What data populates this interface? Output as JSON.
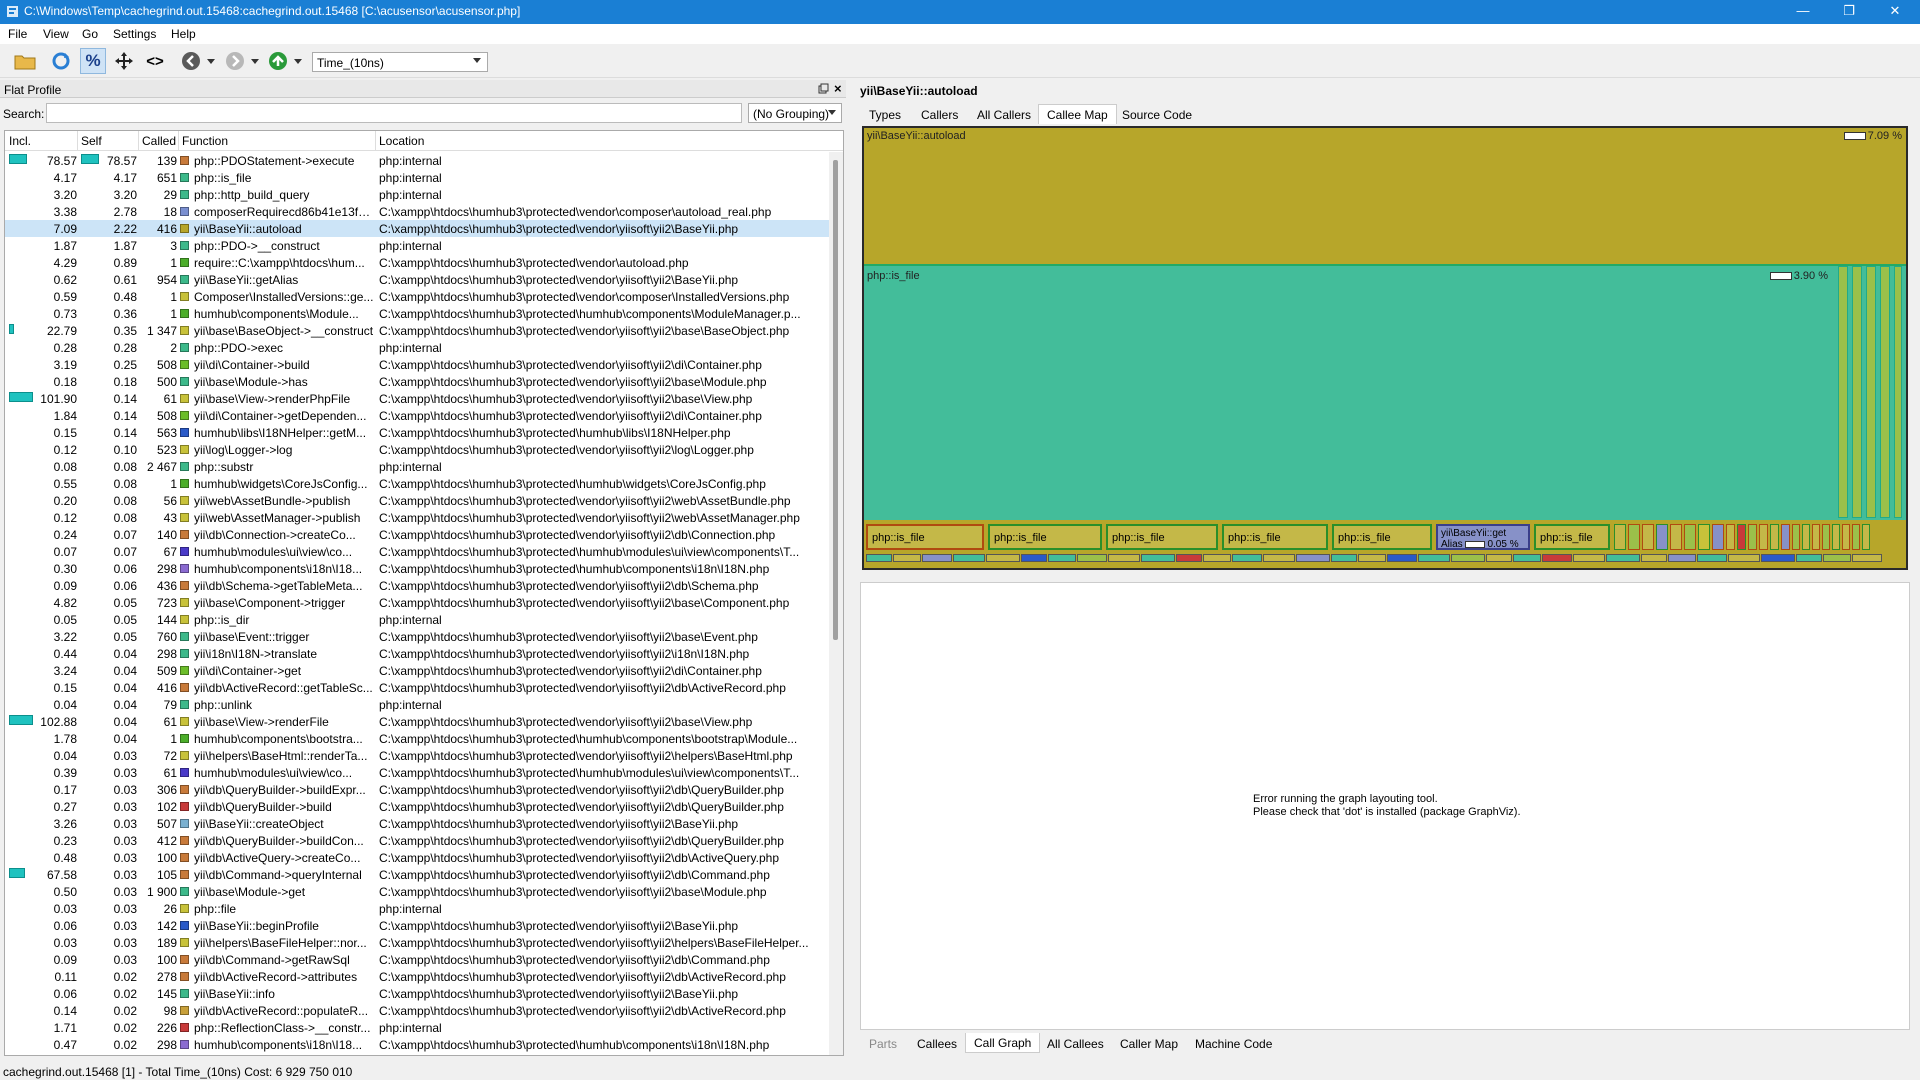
{
  "window": {
    "title": "C:\\Windows\\Temp\\cachegrind.out.15468:cachegrind.out.15468 [C:\\acusensor\\acusensor.php]"
  },
  "menu": [
    "File",
    "View",
    "Go",
    "Settings",
    "Help"
  ],
  "toolbar": {
    "event_type": "Time_(10ns)"
  },
  "flat_profile": {
    "title": "Flat Profile",
    "search_label": "Search:",
    "search_value": "",
    "grouping": "(No Grouping)",
    "columns": [
      "Incl.",
      "Self",
      "Called",
      "Function",
      "Location"
    ],
    "rows": [
      {
        "incl": "78.57",
        "self": "78.57",
        "called": "139",
        "func": "php::PDOStatement->execute",
        "loc": "php:internal",
        "color": "#c87a3a",
        "bar_incl": 0.77,
        "bar_self": 0.77
      },
      {
        "incl": "4.17",
        "self": "4.17",
        "called": "651",
        "func": "php::is_file",
        "loc": "php:internal",
        "color": "#3cb98a"
      },
      {
        "incl": "3.20",
        "self": "3.20",
        "called": "29",
        "func": "php::http_build_query",
        "loc": "php:internal",
        "color": "#3cb98a"
      },
      {
        "incl": "3.38",
        "self": "2.78",
        "called": "18",
        "func": "composerRequirecd86b41e13f5...",
        "loc": "C:\\xampp\\htdocs\\humhub3\\protected\\vendor\\composer\\autoload_real.php",
        "color": "#7a8fd0"
      },
      {
        "incl": "7.09",
        "self": "2.22",
        "called": "416",
        "func": "yii\\BaseYii::autoload",
        "loc": "C:\\xampp\\htdocs\\humhub3\\protected\\vendor\\yiisoft\\yii2\\BaseYii.php",
        "color": "#b7a62a",
        "selected": true
      },
      {
        "incl": "1.87",
        "self": "1.87",
        "called": "3",
        "func": "php::PDO->__construct",
        "loc": "php:internal",
        "color": "#3cb98a"
      },
      {
        "incl": "4.29",
        "self": "0.89",
        "called": "1",
        "func": "require::C:\\xampp\\htdocs\\hum...",
        "loc": "C:\\xampp\\htdocs\\humhub3\\protected\\vendor\\autoload.php",
        "color": "#4cae2a"
      },
      {
        "incl": "0.62",
        "self": "0.61",
        "called": "954",
        "func": "yii\\BaseYii::getAlias",
        "loc": "C:\\xampp\\htdocs\\humhub3\\protected\\vendor\\yiisoft\\yii2\\BaseYii.php",
        "color": "#3cb98a"
      },
      {
        "incl": "0.59",
        "self": "0.48",
        "called": "1",
        "func": "Composer\\InstalledVersions::ge...",
        "loc": "C:\\xampp\\htdocs\\humhub3\\protected\\vendor\\composer\\InstalledVersions.php",
        "color": "#c8c23a"
      },
      {
        "incl": "0.73",
        "self": "0.36",
        "called": "1",
        "func": "humhub\\components\\Module...",
        "loc": "C:\\xampp\\htdocs\\humhub3\\protected\\humhub\\components\\ModuleManager.p...",
        "color": "#4cae2a"
      },
      {
        "incl": "22.79",
        "self": "0.35",
        "called": "1 347",
        "func": "yii\\base\\BaseObject->__construct",
        "loc": "C:\\xampp\\htdocs\\humhub3\\protected\\vendor\\yiisoft\\yii2\\base\\BaseObject.php",
        "color": "#c8c23a",
        "bar_incl": 0.22
      },
      {
        "incl": "0.28",
        "self": "0.28",
        "called": "2",
        "func": "php::PDO->exec",
        "loc": "php:internal",
        "color": "#3cb98a"
      },
      {
        "incl": "3.19",
        "self": "0.25",
        "called": "508",
        "func": "yii\\di\\Container->build",
        "loc": "C:\\xampp\\htdocs\\humhub3\\protected\\vendor\\yiisoft\\yii2\\di\\Container.php",
        "color": "#6cbd2a"
      },
      {
        "incl": "0.18",
        "self": "0.18",
        "called": "500",
        "func": "yii\\base\\Module->has",
        "loc": "C:\\xampp\\htdocs\\humhub3\\protected\\vendor\\yiisoft\\yii2\\base\\Module.php",
        "color": "#3cb98a"
      },
      {
        "incl": "101.90",
        "self": "0.14",
        "called": "61",
        "func": "yii\\base\\View->renderPhpFile",
        "loc": "C:\\xampp\\htdocs\\humhub3\\protected\\vendor\\yiisoft\\yii2\\base\\View.php",
        "color": "#c8c23a",
        "bar_incl": 1.0
      },
      {
        "incl": "1.84",
        "self": "0.14",
        "called": "508",
        "func": "yii\\di\\Container->getDependen...",
        "loc": "C:\\xampp\\htdocs\\humhub3\\protected\\vendor\\yiisoft\\yii2\\di\\Container.php",
        "color": "#6cbd2a"
      },
      {
        "incl": "0.15",
        "self": "0.14",
        "called": "563",
        "func": "humhub\\libs\\I18NHelper::getM...",
        "loc": "C:\\xampp\\htdocs\\humhub3\\protected\\humhub\\libs\\I18NHelper.php",
        "color": "#2a5ac8"
      },
      {
        "incl": "0.12",
        "self": "0.10",
        "called": "523",
        "func": "yii\\log\\Logger->log",
        "loc": "C:\\xampp\\htdocs\\humhub3\\protected\\vendor\\yiisoft\\yii2\\log\\Logger.php",
        "color": "#c8c23a"
      },
      {
        "incl": "0.08",
        "self": "0.08",
        "called": "2 467",
        "func": "php::substr",
        "loc": "php:internal",
        "color": "#3cb98a"
      },
      {
        "incl": "0.55",
        "self": "0.08",
        "called": "1",
        "func": "humhub\\widgets\\CoreJsConfig...",
        "loc": "C:\\xampp\\htdocs\\humhub3\\protected\\humhub\\widgets\\CoreJsConfig.php",
        "color": "#4cae2a"
      },
      {
        "incl": "0.20",
        "self": "0.08",
        "called": "56",
        "func": "yii\\web\\AssetBundle->publish",
        "loc": "C:\\xampp\\htdocs\\humhub3\\protected\\vendor\\yiisoft\\yii2\\web\\AssetBundle.php",
        "color": "#c8c23a"
      },
      {
        "incl": "0.12",
        "self": "0.08",
        "called": "43",
        "func": "yii\\web\\AssetManager->publish",
        "loc": "C:\\xampp\\htdocs\\humhub3\\protected\\vendor\\yiisoft\\yii2\\web\\AssetManager.php",
        "color": "#c8c23a"
      },
      {
        "incl": "0.24",
        "self": "0.07",
        "called": "140",
        "func": "yii\\db\\Connection->createCo...",
        "loc": "C:\\xampp\\htdocs\\humhub3\\protected\\vendor\\yiisoft\\yii2\\db\\Connection.php",
        "color": "#c87a3a"
      },
      {
        "incl": "0.07",
        "self": "0.07",
        "called": "67",
        "func": "humhub\\modules\\ui\\view\\co...",
        "loc": "C:\\xampp\\htdocs\\humhub3\\protected\\humhub\\modules\\ui\\view\\components\\T...",
        "color": "#4a3ac8"
      },
      {
        "incl": "0.30",
        "self": "0.06",
        "called": "298",
        "func": "humhub\\components\\i18n\\I18...",
        "loc": "C:\\xampp\\htdocs\\humhub3\\protected\\humhub\\components\\i18n\\I18N.php",
        "color": "#8a6ad0"
      },
      {
        "incl": "0.09",
        "self": "0.06",
        "called": "436",
        "func": "yii\\db\\Schema->getTableMeta...",
        "loc": "C:\\xampp\\htdocs\\humhub3\\protected\\vendor\\yiisoft\\yii2\\db\\Schema.php",
        "color": "#c87a3a"
      },
      {
        "incl": "4.82",
        "self": "0.05",
        "called": "723",
        "func": "yii\\base\\Component->trigger",
        "loc": "C:\\xampp\\htdocs\\humhub3\\protected\\vendor\\yiisoft\\yii2\\base\\Component.php",
        "color": "#c8c23a"
      },
      {
        "incl": "0.05",
        "self": "0.05",
        "called": "144",
        "func": "php::is_dir",
        "loc": "php:internal",
        "color": "#c8c23a"
      },
      {
        "incl": "3.22",
        "self": "0.05",
        "called": "760",
        "func": "yii\\base\\Event::trigger",
        "loc": "C:\\xampp\\htdocs\\humhub3\\protected\\vendor\\yiisoft\\yii2\\base\\Event.php",
        "color": "#3cb98a"
      },
      {
        "incl": "0.44",
        "self": "0.04",
        "called": "298",
        "func": "yii\\i18n\\I18N->translate",
        "loc": "C:\\xampp\\htdocs\\humhub3\\protected\\vendor\\yiisoft\\yii2\\i18n\\I18N.php",
        "color": "#3cb98a"
      },
      {
        "incl": "3.24",
        "self": "0.04",
        "called": "509",
        "func": "yii\\di\\Container->get",
        "loc": "C:\\xampp\\htdocs\\humhub3\\protected\\vendor\\yiisoft\\yii2\\di\\Container.php",
        "color": "#6cbd2a"
      },
      {
        "incl": "0.15",
        "self": "0.04",
        "called": "416",
        "func": "yii\\db\\ActiveRecord::getTableSc...",
        "loc": "C:\\xampp\\htdocs\\humhub3\\protected\\vendor\\yiisoft\\yii2\\db\\ActiveRecord.php",
        "color": "#c87a3a"
      },
      {
        "incl": "0.04",
        "self": "0.04",
        "called": "79",
        "func": "php::unlink",
        "loc": "php:internal",
        "color": "#3cb98a"
      },
      {
        "incl": "102.88",
        "self": "0.04",
        "called": "61",
        "func": "yii\\base\\View->renderFile",
        "loc": "C:\\xampp\\htdocs\\humhub3\\protected\\vendor\\yiisoft\\yii2\\base\\View.php",
        "color": "#c8c23a",
        "bar_incl": 1.0
      },
      {
        "incl": "1.78",
        "self": "0.04",
        "called": "1",
        "func": "humhub\\components\\bootstra...",
        "loc": "C:\\xampp\\htdocs\\humhub3\\protected\\humhub\\components\\bootstrap\\Module...",
        "color": "#4cae2a"
      },
      {
        "incl": "0.04",
        "self": "0.03",
        "called": "72",
        "func": "yii\\helpers\\BaseHtml::renderTa...",
        "loc": "C:\\xampp\\htdocs\\humhub3\\protected\\vendor\\yiisoft\\yii2\\helpers\\BaseHtml.php",
        "color": "#c8c23a"
      },
      {
        "incl": "0.39",
        "self": "0.03",
        "called": "61",
        "func": "humhub\\modules\\ui\\view\\co...",
        "loc": "C:\\xampp\\htdocs\\humhub3\\protected\\humhub\\modules\\ui\\view\\components\\T...",
        "color": "#4a3ac8"
      },
      {
        "incl": "0.17",
        "self": "0.03",
        "called": "306",
        "func": "yii\\db\\QueryBuilder->buildExpr...",
        "loc": "C:\\xampp\\htdocs\\humhub3\\protected\\vendor\\yiisoft\\yii2\\db\\QueryBuilder.php",
        "color": "#c87a3a"
      },
      {
        "incl": "0.27",
        "self": "0.03",
        "called": "102",
        "func": "yii\\db\\QueryBuilder->build",
        "loc": "C:\\xampp\\htdocs\\humhub3\\protected\\vendor\\yiisoft\\yii2\\db\\QueryBuilder.php",
        "color": "#c83a3a"
      },
      {
        "incl": "3.26",
        "self": "0.03",
        "called": "507",
        "func": "yii\\BaseYii::createObject",
        "loc": "C:\\xampp\\htdocs\\humhub3\\protected\\vendor\\yiisoft\\yii2\\BaseYii.php",
        "color": "#7ab0d0"
      },
      {
        "incl": "0.23",
        "self": "0.03",
        "called": "412",
        "func": "yii\\db\\QueryBuilder->buildCon...",
        "loc": "C:\\xampp\\htdocs\\humhub3\\protected\\vendor\\yiisoft\\yii2\\db\\QueryBuilder.php",
        "color": "#c87a3a"
      },
      {
        "incl": "0.48",
        "self": "0.03",
        "called": "100",
        "func": "yii\\db\\ActiveQuery->createCo...",
        "loc": "C:\\xampp\\htdocs\\humhub3\\protected\\vendor\\yiisoft\\yii2\\db\\ActiveQuery.php",
        "color": "#c87a3a"
      },
      {
        "incl": "67.58",
        "self": "0.03",
        "called": "105",
        "func": "yii\\db\\Command->queryInternal",
        "loc": "C:\\xampp\\htdocs\\humhub3\\protected\\vendor\\yiisoft\\yii2\\db\\Command.php",
        "color": "#c87a3a",
        "bar_incl": 0.66
      },
      {
        "incl": "0.50",
        "self": "0.03",
        "called": "1 900",
        "func": "yii\\base\\Module->get",
        "loc": "C:\\xampp\\htdocs\\humhub3\\protected\\vendor\\yiisoft\\yii2\\base\\Module.php",
        "color": "#3cb98a"
      },
      {
        "incl": "0.03",
        "self": "0.03",
        "called": "26",
        "func": "php::file",
        "loc": "php:internal",
        "color": "#c8c23a"
      },
      {
        "incl": "0.06",
        "self": "0.03",
        "called": "142",
        "func": "yii\\BaseYii::beginProfile",
        "loc": "C:\\xampp\\htdocs\\humhub3\\protected\\vendor\\yiisoft\\yii2\\BaseYii.php",
        "color": "#2a5ac8"
      },
      {
        "incl": "0.03",
        "self": "0.03",
        "called": "189",
        "func": "yii\\helpers\\BaseFileHelper::nor...",
        "loc": "C:\\xampp\\htdocs\\humhub3\\protected\\vendor\\yiisoft\\yii2\\helpers\\BaseFileHelper...",
        "color": "#c8c23a"
      },
      {
        "incl": "0.09",
        "self": "0.03",
        "called": "100",
        "func": "yii\\db\\Command->getRawSql",
        "loc": "C:\\xampp\\htdocs\\humhub3\\protected\\vendor\\yiisoft\\yii2\\db\\Command.php",
        "color": "#c87a3a"
      },
      {
        "incl": "0.11",
        "self": "0.02",
        "called": "278",
        "func": "yii\\db\\ActiveRecord->attributes",
        "loc": "C:\\xampp\\htdocs\\humhub3\\protected\\vendor\\yiisoft\\yii2\\db\\ActiveRecord.php",
        "color": "#c87a3a"
      },
      {
        "incl": "0.06",
        "self": "0.02",
        "called": "145",
        "func": "yii\\BaseYii::info",
        "loc": "C:\\xampp\\htdocs\\humhub3\\protected\\vendor\\yiisoft\\yii2\\BaseYii.php",
        "color": "#3cb98a"
      },
      {
        "incl": "0.14",
        "self": "0.02",
        "called": "98",
        "func": "yii\\db\\ActiveRecord::populateR...",
        "loc": "C:\\xampp\\htdocs\\humhub3\\protected\\vendor\\yiisoft\\yii2\\db\\ActiveRecord.php",
        "color": "#c8a03a"
      },
      {
        "incl": "1.71",
        "self": "0.02",
        "called": "226",
        "func": "php::ReflectionClass->__constr...",
        "loc": "php:internal",
        "color": "#c83a3a"
      },
      {
        "incl": "0.47",
        "self": "0.02",
        "called": "298",
        "func": "humhub\\components\\i18n\\I18...",
        "loc": "C:\\xampp\\htdocs\\humhub3\\protected\\humhub\\components\\i18n\\I18N.php",
        "color": "#8a6ad0"
      }
    ]
  },
  "detail": {
    "title": "yii\\BaseYii::autoload",
    "tabs_top": [
      "Types",
      "Callers",
      "All Callers",
      "Callee Map",
      "Source Code"
    ],
    "tabs_bottom": [
      "Parts",
      "Callees",
      "Call Graph",
      "All Callees",
      "Caller Map",
      "Machine Code"
    ],
    "map": {
      "root_label": "yii\\BaseYii::autoload",
      "root_pct": "7.09 %",
      "child_label": "php::is_file",
      "child_pct": "3.90 %",
      "cells": [
        "php::is_file",
        "php::is_file",
        "php::is_file",
        "php::is_file",
        "php::is_file",
        "php::is_file"
      ],
      "alias_cell_title": "yii\\BaseYii::get",
      "alias_cell_sub": "Alias",
      "alias_cell_pct": "0.05 %"
    },
    "graph_msg_1": "Error running the graph layouting tool.",
    "graph_msg_2": "Please check that 'dot' is installed (package GraphViz)."
  },
  "status": "cachegrind.out.15468 [1] - Total Time_(10ns) Cost: 6 929 750 010"
}
